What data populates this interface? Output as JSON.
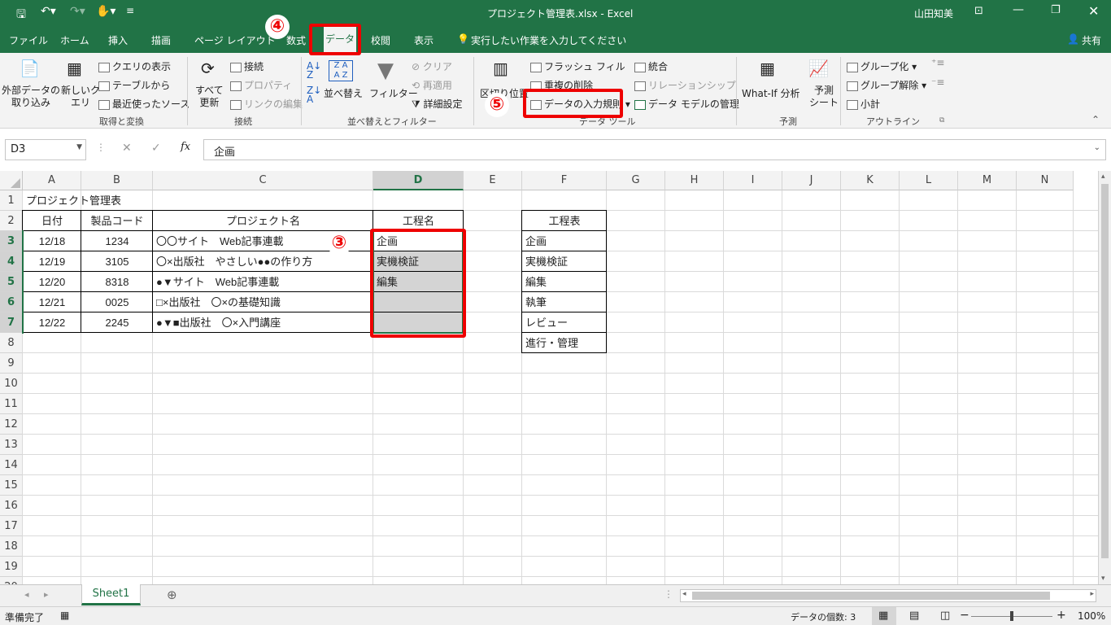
{
  "window": {
    "title": "プロジェクト管理表.xlsx  -  Excel",
    "user": "山田知美",
    "share": "共有"
  },
  "tabs": [
    "ファイル",
    "ホーム",
    "挿入",
    "描画",
    "ページ レイアウト",
    "数式",
    "データ",
    "校閲",
    "表示"
  ],
  "tell_me": "実行したい作業を入力してください",
  "ribbon": {
    "external_data": "外部データの\n取り込み",
    "new_query": "新しいク\nエリ",
    "show_queries": "クエリの表示",
    "from_table": "テーブルから",
    "recent_sources": "最近使ったソース",
    "group_get": "取得と変換",
    "refresh_all": "すべて\n更新",
    "connections": "接続",
    "properties": "プロパティ",
    "edit_links": "リンクの編集",
    "group_conn": "接続",
    "sort": "並べ替え",
    "filter": "フィルター",
    "clear": "クリア",
    "reapply": "再適用",
    "advanced": "詳細設定",
    "group_sort": "並べ替えとフィルター",
    "text_to_columns": "区切り位置",
    "flash_fill": "フラッシュ フィル",
    "remove_dup": "重複の削除",
    "data_validation": "データの入力規則",
    "consolidate": "統合",
    "relationships": "リレーションシップ",
    "data_model": "データ モデルの管理",
    "group_tools": "データ ツール",
    "whatif": "What-If 分析",
    "forecast_sheet": "予測\nシート",
    "group_forecast": "予測",
    "group_btn": "グループ化",
    "ungroup": "グループ解除",
    "subtotal": "小計",
    "group_outline": "アウトライン"
  },
  "formula_bar": {
    "name_box": "D3",
    "fx": "fx",
    "value": "企画"
  },
  "columns": [
    "A",
    "B",
    "C",
    "D",
    "E",
    "F",
    "G",
    "H",
    "I",
    "J",
    "K",
    "L",
    "M",
    "N"
  ],
  "rows": [
    "1",
    "2",
    "3",
    "4",
    "5",
    "6",
    "7",
    "8",
    "9",
    "10",
    "11",
    "12",
    "13",
    "14",
    "15",
    "16",
    "17",
    "18",
    "19",
    "20"
  ],
  "sheet": {
    "title": "プロジェクト管理表",
    "headers": [
      "日付",
      "製品コード",
      "プロジェクト名",
      "工程名"
    ],
    "data": [
      [
        "12/18",
        "1234",
        "〇〇サイト　Web記事連載",
        "企画"
      ],
      [
        "12/19",
        "3105",
        "〇×出版社　やさしい●●の作り方",
        "実機検証"
      ],
      [
        "12/20",
        "8318",
        "●▼サイト　Web記事連載",
        "編集"
      ],
      [
        "12/21",
        "0025",
        "□×出版社　〇×の基礎知識",
        ""
      ],
      [
        "12/22",
        "2245",
        "●▼■出版社　〇×入門講座",
        ""
      ]
    ],
    "process_header": "工程表",
    "process_list": [
      "企画",
      "実機検証",
      "編集",
      "執筆",
      "レビュー",
      "進行・管理"
    ]
  },
  "annotations": {
    "step3": "③",
    "step4": "④",
    "step5": "⑤"
  },
  "sheet_tab": "Sheet1",
  "status": {
    "ready": "準備完了",
    "count": "データの個数: 3",
    "zoom": "100%"
  }
}
